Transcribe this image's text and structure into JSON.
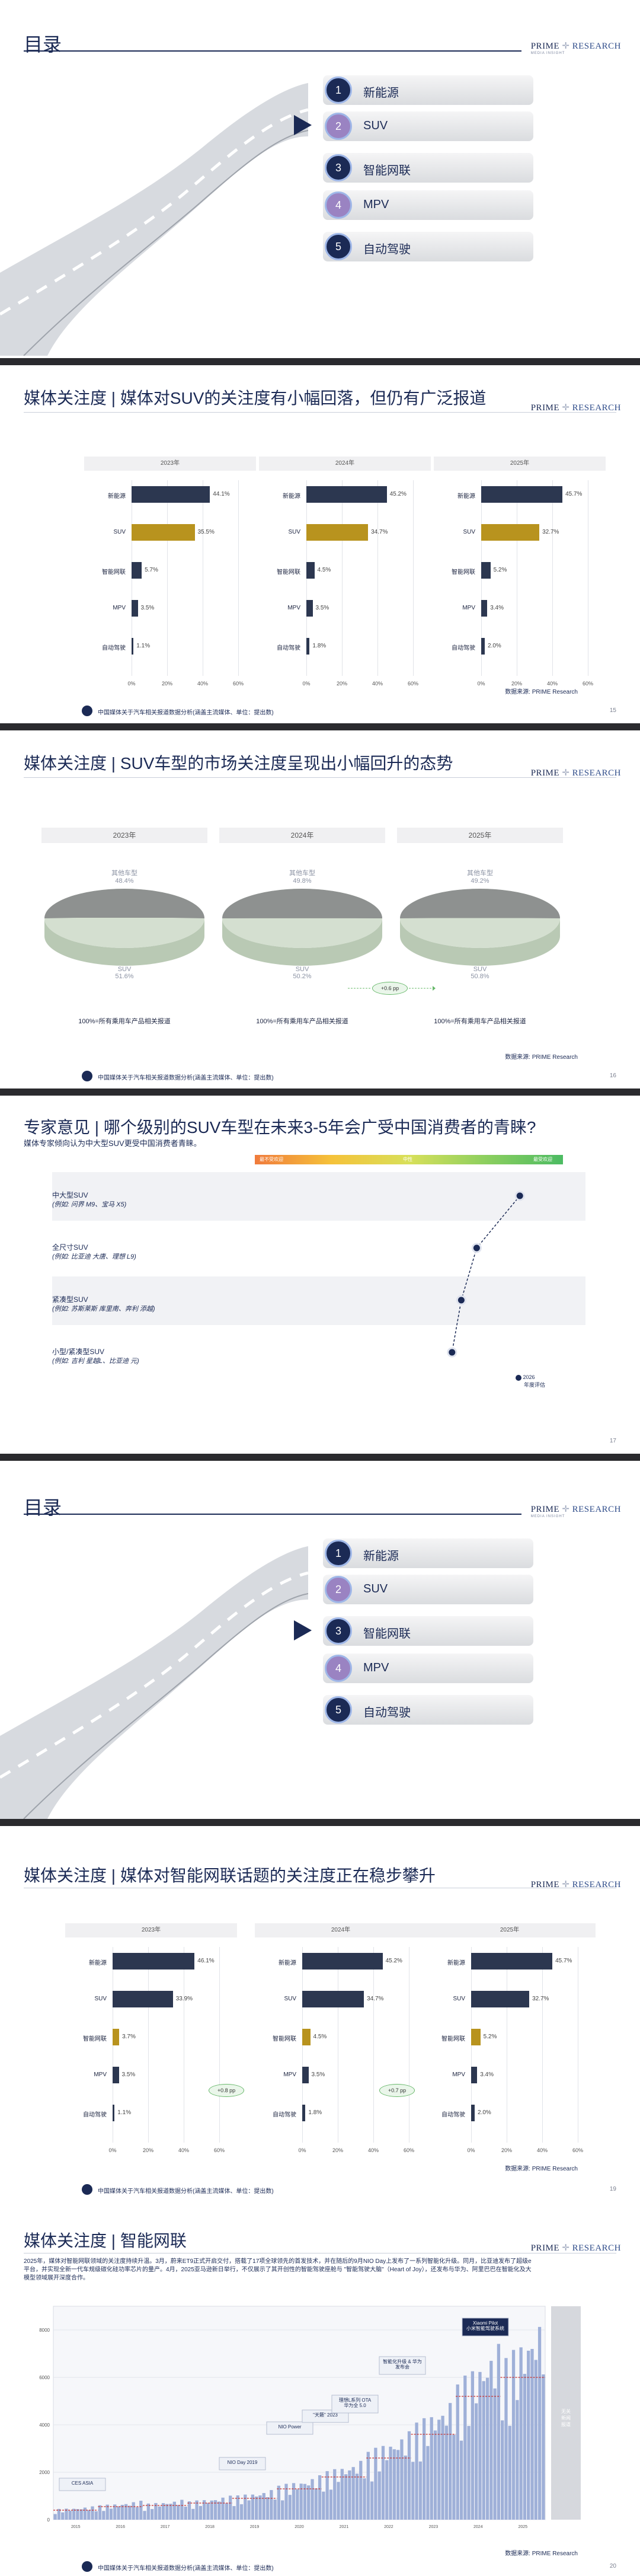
{
  "logo": {
    "brand_a": "PRIME",
    "brand_b": "RESEARCH",
    "sub": "MEDIA INSIGHT"
  },
  "footer": {
    "text": "中国媒体关于汽车相关报道数据分析(涵盖主流媒体、单位：提出数)",
    "mini": "",
    "source": "数据来源: PRIME Research"
  },
  "agenda": {
    "title": "目录",
    "items": [
      {
        "num": "1",
        "label": "新能源",
        "color": "#1b2a55"
      },
      {
        "num": "2",
        "label": "SUV",
        "color": "#9a83c2"
      },
      {
        "num": "3",
        "label": "智能网联",
        "color": "#1b2a55"
      },
      {
        "num": "4",
        "label": "MPV",
        "color": "#9a83c2"
      },
      {
        "num": "5",
        "label": "自动驾驶",
        "color": "#1b2a55"
      }
    ]
  },
  "slide2": {
    "title": "媒体关注度 | 媒体对SUV的关注度有小幅回落，但仍有广泛报道",
    "page": "15",
    "chart_data": [
      {
        "type": "bar",
        "title": "2023年",
        "categories": [
          "新能源",
          "SUV",
          "智能网联",
          "MPV",
          "自动驾驶"
        ],
        "values": [
          44.1,
          35.5,
          5.7,
          3.5,
          1.1
        ],
        "xlim": [
          0,
          60
        ],
        "ticks": [
          "0%",
          "20%",
          "40%",
          "60%"
        ]
      },
      {
        "type": "bar",
        "title": "2024年",
        "categories": [
          "新能源",
          "SUV",
          "智能网联",
          "MPV",
          "自动驾驶"
        ],
        "values": [
          45.2,
          34.7,
          4.5,
          3.5,
          1.8
        ],
        "xlim": [
          0,
          60
        ],
        "ticks": [
          "0%",
          "20%",
          "40%",
          "60%"
        ]
      },
      {
        "type": "bar",
        "title": "2025年",
        "categories": [
          "新能源",
          "SUV",
          "智能网联",
          "MPV",
          "自动驾驶"
        ],
        "values": [
          45.7,
          32.7,
          5.2,
          3.4,
          2.0
        ],
        "xlim": [
          0,
          60
        ],
        "ticks": [
          "0%",
          "20%",
          "40%",
          "60%"
        ]
      }
    ],
    "highlight": "SUV",
    "source": "数据来源: PRIME Research"
  },
  "slide3": {
    "title": "媒体关注度 | SUV车型的市场关注度呈现出小幅回升的态势",
    "page": "16",
    "chart_data": [
      {
        "type": "pie",
        "title": "2023年",
        "labels": [
          "其他车型",
          "SUV"
        ],
        "values": [
          48.4,
          51.6
        ]
      },
      {
        "type": "pie",
        "title": "2024年",
        "labels": [
          "其他车型",
          "SUV"
        ],
        "values": [
          49.8,
          50.2
        ]
      },
      {
        "type": "pie",
        "title": "2025年",
        "labels": [
          "其他车型",
          "SUV"
        ],
        "values": [
          49.2,
          50.8
        ]
      }
    ],
    "top_labels": [
      "其他车型\n48.4%",
      "其他车型\n49.8%",
      "其他车型\n49.2%"
    ],
    "bottom_labels": [
      "SUV\n51.6%",
      "SUV\n50.2%",
      "SUV\n50.8%"
    ],
    "foot": "100%=所有乘用车产品相关报道",
    "badge": "+0.6 pp",
    "source": "数据来源: PRIME Research"
  },
  "slide4": {
    "title": "专家意见 | 哪个级别的SUV车型在未来3-5年会广受中国消费者的青睐?",
    "subtitle": "媒体专家倾向认为中大型SUV更受中国消费者青睐。",
    "scale_left": "最不受欢迎",
    "scale_mid": "中性",
    "scale_right": "最受欢迎",
    "page": "17",
    "legend": [
      "2026",
      "年度评估"
    ],
    "rows": [
      {
        "name": "中大型SUV",
        "example": "(例如: 问界 M9、宝马 X5)"
      },
      {
        "name": "全尺寸SUV",
        "example": "(例如: 比亚迪 大唐、理想 L9)"
      },
      {
        "name": "紧凑型SUV",
        "example": "(例如: 苏斯莱斯 库里南、奔利 添越)"
      },
      {
        "name": "小型/紧凑型SUV",
        "example": "(例如: 吉利 星越L、比亚迪 元)"
      }
    ],
    "chart_data": {
      "type": "scatter",
      "categories": [
        "中大型SUV",
        "全尺寸SUV",
        "紧凑型SUV",
        "小型/紧凑型SUV"
      ],
      "values": [
        0.86,
        0.72,
        0.67,
        0.64
      ],
      "xlim": [
        0,
        1
      ]
    }
  },
  "agenda2": {
    "active": 2
  },
  "slide6": {
    "title": "媒体关注度 | 媒体对智能网联话题的关注度正在稳步攀升",
    "page": "19",
    "chart_data": [
      {
        "type": "bar",
        "title": "2023年",
        "categories": [
          "新能源",
          "SUV",
          "智能网联",
          "MPV",
          "自动驾驶"
        ],
        "values": [
          46.1,
          33.9,
          3.7,
          3.5,
          1.1
        ],
        "xlim": [
          0,
          60
        ],
        "ticks": [
          "0%",
          "20%",
          "40%",
          "60%"
        ]
      },
      {
        "type": "bar",
        "title": "2024年",
        "categories": [
          "新能源",
          "SUV",
          "智能网联",
          "MPV",
          "自动驾驶"
        ],
        "values": [
          45.2,
          34.7,
          4.5,
          3.5,
          1.8
        ],
        "xlim": [
          0,
          60
        ],
        "ticks": [
          "0%",
          "20%",
          "40%",
          "60%"
        ]
      },
      {
        "type": "bar",
        "title": "2025年",
        "categories": [
          "新能源",
          "SUV",
          "智能网联",
          "MPV",
          "自动驾驶"
        ],
        "values": [
          45.7,
          32.7,
          5.2,
          3.4,
          2.0
        ],
        "xlim": [
          0,
          60
        ],
        "ticks": [
          "0%",
          "20%",
          "40%",
          "60%"
        ]
      }
    ],
    "highlight": "智能网联",
    "badges": [
      "+0.8 pp",
      "+0.7 pp"
    ],
    "source": "数据来源: PRIME Research"
  },
  "slide7": {
    "title": "媒体关注度 | 智能网联",
    "page": "20",
    "paragraph": "2025年，媒体对智能网联领域的关注度持续升温。3月，蔚来ET9正式开启交付，搭载了17项全球领先的首发技术，并在随后的9月NIO Day上发布了一系列智能化升级。同月，比亚迪发布了超级e平台，并实现全新一代车规级碳化硅功率芯片的量产。4月，2025亚马逊新日举行，不仅展示了其开创性的智能驾驶座舱与 \"智能驾驶大脑\"（Heart of Joy），还发布与华为、阿里巴巴在智能化及大模型领域展开深度合作。",
    "events": [
      "CES ASIA",
      "NIO Day 2019",
      "NIO Power",
      "\"天籁\" 2023",
      "理想L系列 OTA\n华为全 5.0",
      "智能化升级 & 华为\n发布会",
      "Xiaomi Pilot\n小米智能驾驶系统"
    ],
    "y_ticks": [
      "0",
      "2000",
      "4000",
      "6000",
      "8000"
    ],
    "x_ticks": [
      "2015",
      "2016",
      "2017",
      "2018",
      "2019",
      "2020",
      "2021",
      "2022",
      "2023",
      "2024",
      "2025"
    ],
    "side_label": "无关\n新闻\n报道",
    "chart_data": {
      "type": "bar",
      "title": "",
      "xlabel": "",
      "ylabel": "",
      "ylim": [
        0,
        9000
      ],
      "categories": [
        "2015",
        "2016",
        "2017",
        "2018",
        "2019",
        "2020",
        "2021",
        "2022",
        "2023",
        "2024",
        "2025"
      ],
      "values": [
        400,
        550,
        600,
        700,
        900,
        1300,
        1800,
        2600,
        3600,
        5200,
        6000
      ]
    },
    "source": "数据来源: PRIME Research"
  }
}
